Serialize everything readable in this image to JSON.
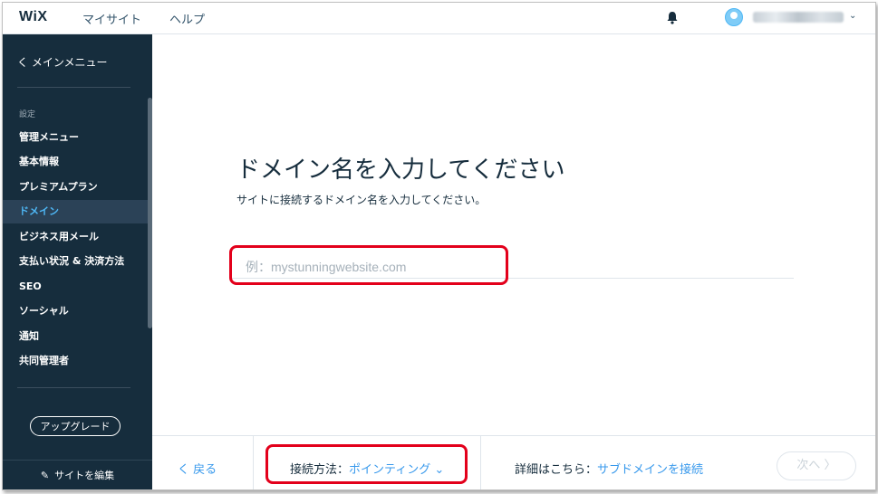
{
  "header": {
    "logo": "WiX",
    "nav": [
      "マイサイト",
      "ヘルプ"
    ],
    "account_chevron": "⌄"
  },
  "sidebar": {
    "back_label": "く メインメニュー",
    "section_label": "設定",
    "items": [
      {
        "label": "管理メニュー",
        "active": false
      },
      {
        "label": "基本情報",
        "active": false
      },
      {
        "label": "プレミアムプラン",
        "active": false
      },
      {
        "label": "ドメイン",
        "active": true
      },
      {
        "label": "ビジネス用メール",
        "active": false
      },
      {
        "label": "支払い状況 & 決済方法",
        "active": false
      },
      {
        "label": "SEO",
        "active": false
      },
      {
        "label": "ソーシャル",
        "active": false
      },
      {
        "label": "通知",
        "active": false
      },
      {
        "label": "共同管理者",
        "active": false
      }
    ],
    "upgrade_label": "アップグレード",
    "edit_site_label": "サイトを編集"
  },
  "main": {
    "title": "ドメイン名を入力してください",
    "subtitle": "サイトに接続するドメイン名を入力してください。",
    "domain_input": {
      "value": "",
      "placeholder": "例：mystunningwebsite.com"
    }
  },
  "footer": {
    "back_label": "く 戻る",
    "connection_label": "接続方法：",
    "connection_value": "ポインティング ⌄",
    "details_label": "詳細はこちら：",
    "details_link": "サブドメインを接続",
    "next_label": "次へ 〉"
  },
  "colors": {
    "sidebar_bg": "#162d3d",
    "accent": "#3899ec",
    "highlight_red": "#e3001b"
  }
}
